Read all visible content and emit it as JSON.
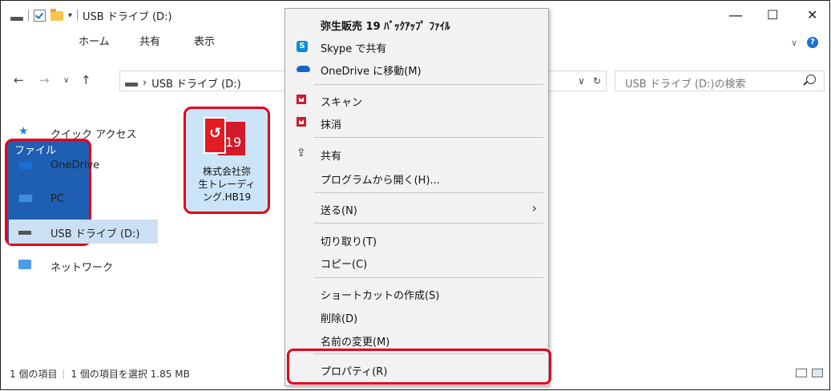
{
  "window": {
    "title": "USB ドライブ (D:)",
    "controls": [
      "—",
      "☐",
      "✕"
    ]
  },
  "ribbon": {
    "tabs": [
      "ファイル",
      "ホーム",
      "共有",
      "表示"
    ],
    "help": "?"
  },
  "address": {
    "crumbs": [
      "USB ドライブ (D:)"
    ],
    "search_placeholder": "USB ドライブ (D:)の検索"
  },
  "sidebar": {
    "items": [
      {
        "label": "クイック アクセス",
        "icon": "star-icon"
      },
      {
        "label": "OneDrive",
        "icon": "cloud-icon"
      },
      {
        "label": "PC",
        "icon": "pc-icon"
      },
      {
        "label": "USB ドライブ (D:)",
        "icon": "usb-drive-icon",
        "selected": true
      },
      {
        "label": "ネットワーク",
        "icon": "network-icon"
      }
    ]
  },
  "file": {
    "name_lines": [
      "株式会社弥",
      "生トレーディ",
      "ング.HB19"
    ],
    "badge": "19"
  },
  "status": {
    "items_count": "1 個の項目",
    "selected": "1 個の項目を選択  1.85 MB"
  },
  "context_menu": {
    "header": "弥生販売 19 ﾊﾞｯｸｱｯﾌﾟ ﾌｧｲﾙ",
    "items": [
      {
        "label": "Skype で共有",
        "icon": "skype-icon"
      },
      {
        "label": "OneDrive に移動(M)",
        "icon": "onedrive-icon"
      },
      {
        "label": "スキャン",
        "icon": "mcafee-icon"
      },
      {
        "label": "抹消",
        "icon": "mcafee-icon"
      },
      {
        "label": "共有",
        "icon": "share-icon"
      },
      {
        "label": "プログラムから開く(H)...",
        "icon": ""
      },
      {
        "label": "送る(N)",
        "icon": "",
        "submenu": true
      },
      {
        "label": "切り取り(T)",
        "icon": ""
      },
      {
        "label": "コピー(C)",
        "icon": ""
      },
      {
        "label": "ショートカットの作成(S)",
        "icon": ""
      },
      {
        "label": "削除(D)",
        "icon": ""
      },
      {
        "label": "名前の変更(M)",
        "icon": ""
      },
      {
        "label": "プロパティ(R)",
        "icon": "",
        "highlighted": true
      }
    ]
  },
  "colors": {
    "accent": "#1f5fb3",
    "highlight": "#e1001c",
    "selection": "#cce0f4"
  }
}
